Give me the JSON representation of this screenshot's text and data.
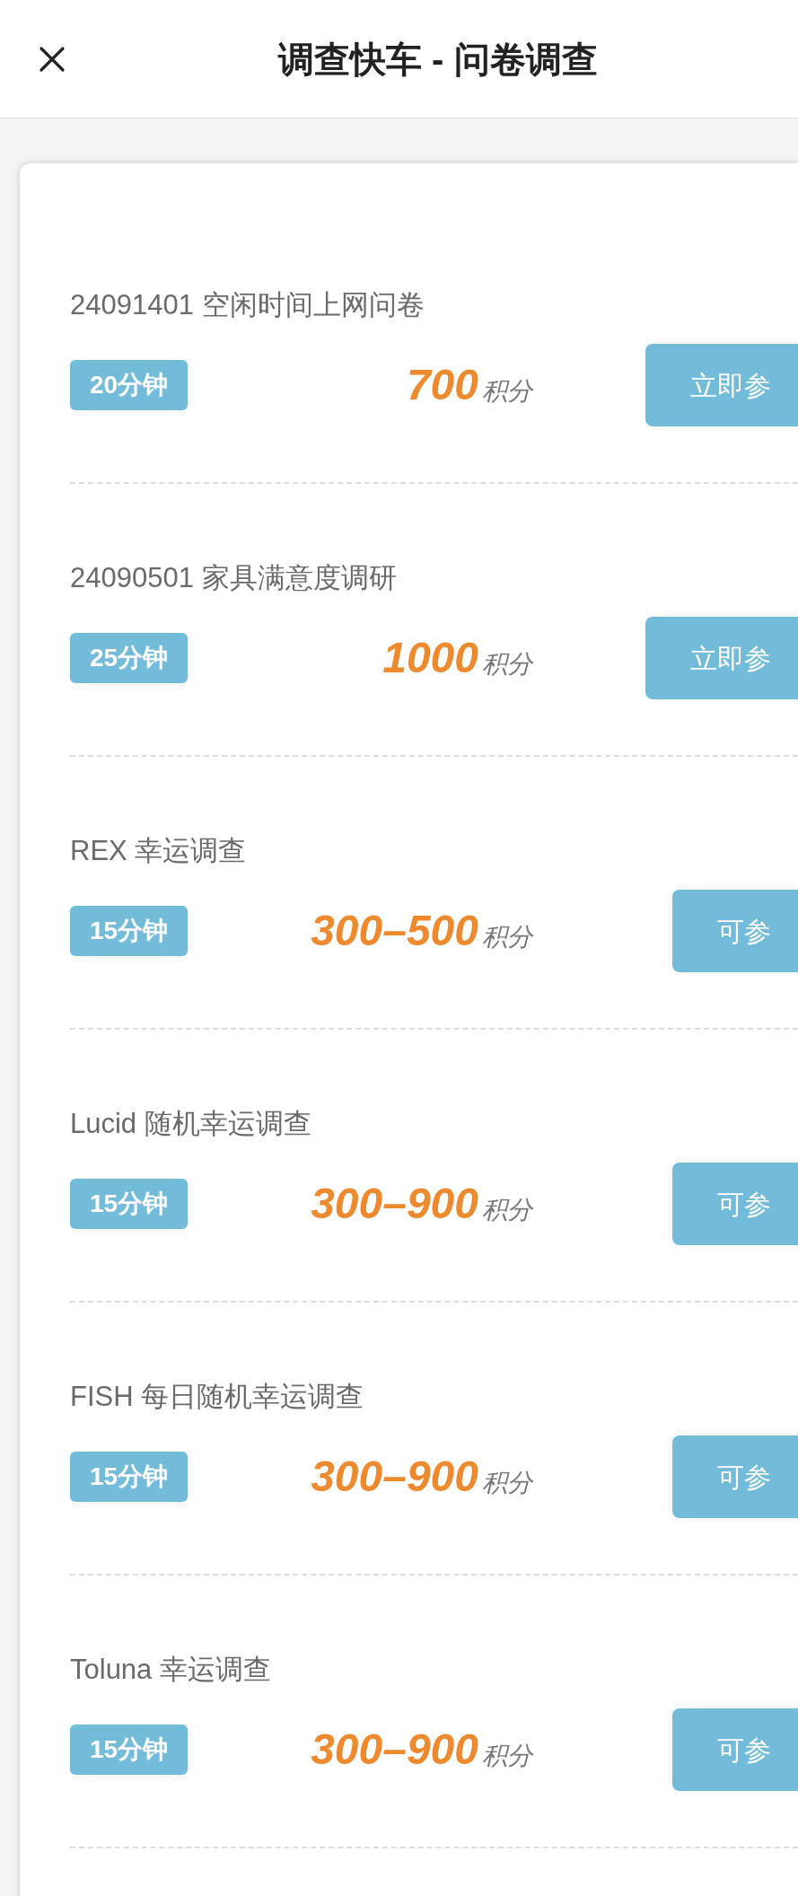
{
  "header": {
    "title": "调查快车 - 问卷调查"
  },
  "surveys": [
    {
      "title": "24091401 空闲时间上网问卷",
      "duration": "20分钟",
      "points": "700",
      "unit": "积分",
      "button": "立即参"
    },
    {
      "title": "24090501 家具满意度调研",
      "duration": "25分钟",
      "points": "1000",
      "unit": "积分",
      "button": "立即参"
    },
    {
      "title": "REX 幸运调查",
      "duration": "15分钟",
      "points": "300–500",
      "unit": "积分",
      "button": "可参"
    },
    {
      "title": "Lucid 随机幸运调查",
      "duration": "15分钟",
      "points": "300–900",
      "unit": "积分",
      "button": "可参"
    },
    {
      "title": "FISH 每日随机幸运调查",
      "duration": "15分钟",
      "points": "300–900",
      "unit": "积分",
      "button": "可参"
    },
    {
      "title": "Toluna 幸运调查",
      "duration": "15分钟",
      "points": "300–900",
      "unit": "积分",
      "button": "可参"
    }
  ]
}
